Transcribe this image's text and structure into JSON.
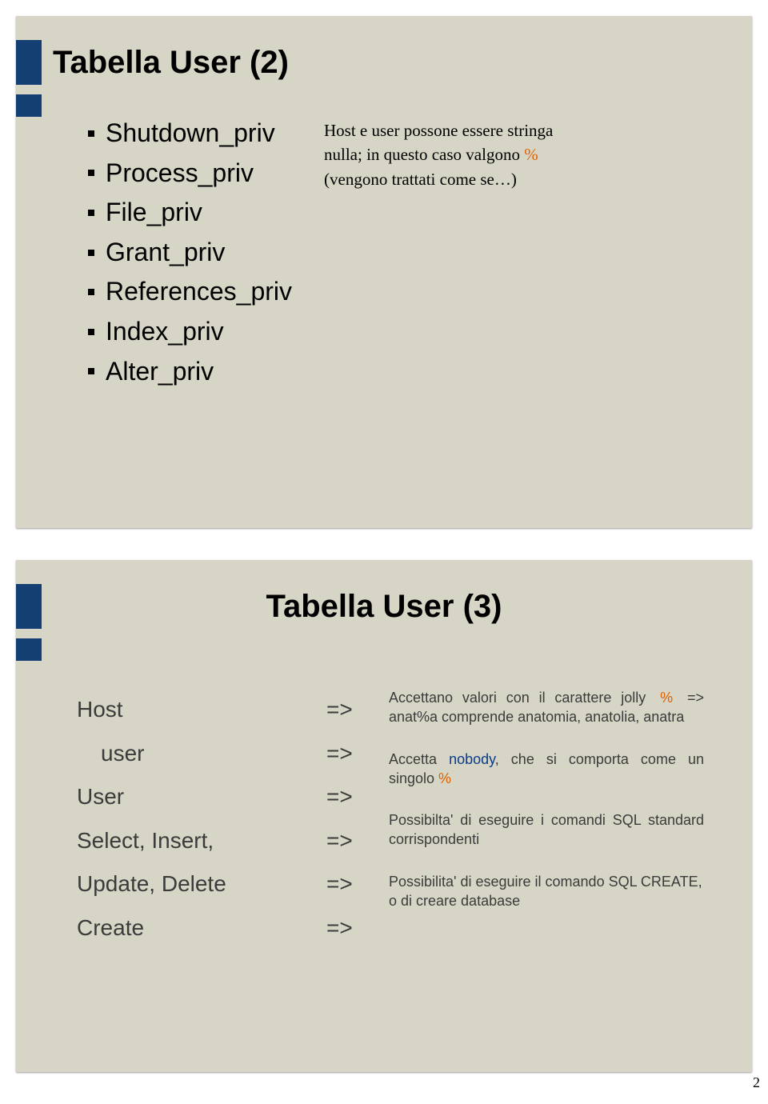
{
  "page_number": "2",
  "slide1": {
    "title": "Tabella User (2)",
    "bullets": [
      "Shutdown_priv",
      "Process_priv",
      "File_priv",
      "Grant_priv",
      "References_priv",
      "Index_priv",
      "Alter_priv"
    ],
    "note_line1": "Host e user possone essere stringa nulla; in questo caso valgono ",
    "note_pct": "%",
    "note_line2": " (vengono trattati come se…)"
  },
  "slide2": {
    "title": "Tabella User (3)",
    "rows": {
      "host_label": "Host",
      "user_sub_label": "user",
      "user_label": "User",
      "select_label": "Select, Insert,",
      "update_label": "Update, Delete",
      "create_label": "Create",
      "arrow": "=>"
    },
    "desc1_a": "Accettano valori con il carattere jolly",
    "desc1_pct": "%",
    "desc1_arrow": "=>",
    "desc1_b": "anat%a comprende anatomia, anatolia, anatra",
    "desc2_a": "Accetta ",
    "desc2_nobody": "nobody",
    "desc2_b": ", che si comporta come un singolo ",
    "desc2_pct": "%",
    "desc3": "Possibilta' di eseguire i comandi SQL standard corrispondenti",
    "desc4": "Possibilita' di eseguire il comando SQL CREATE, o di creare database"
  }
}
